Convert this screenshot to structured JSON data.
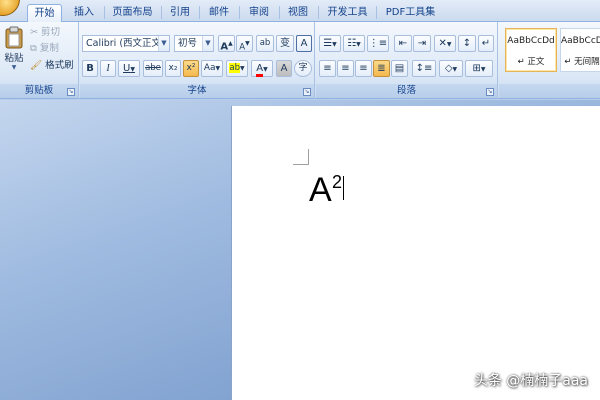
{
  "tabs": [
    {
      "label": "开始"
    },
    {
      "label": "插入"
    },
    {
      "label": "页面布局"
    },
    {
      "label": "引用"
    },
    {
      "label": "邮件"
    },
    {
      "label": "审阅"
    },
    {
      "label": "视图"
    },
    {
      "label": "开发工具"
    },
    {
      "label": "PDF工具集"
    }
  ],
  "clipboard": {
    "paste": "粘贴",
    "cut": "剪切",
    "copy": "复制",
    "format_painter": "格式刷",
    "label": "剪贴板"
  },
  "font": {
    "font_name": "Calibri (西文正文)",
    "font_size": "初号",
    "grow_glyph": "A",
    "shrink_glyph": "A",
    "clear_glyph": "ab",
    "phonetic_glyph": "变",
    "border_glyph": "A",
    "bold": "B",
    "italic": "I",
    "underline": "U",
    "strike": "abe",
    "subscript": "x₂",
    "superscript": "x²",
    "change_case": "Aa",
    "highlight": "ab",
    "font_color": "A",
    "shading_glyph": "A",
    "enclose_glyph": "字",
    "label": "字体"
  },
  "paragraph": {
    "label": "段落"
  },
  "styles": {
    "items": [
      {
        "sample": "AaBbCcDd",
        "name": "↵ 正文"
      },
      {
        "sample": "AaBbCcDd",
        "name": "↵ 无间隔"
      }
    ]
  },
  "document": {
    "base_text": "A",
    "superscript_text": "2"
  },
  "watermark": "头条 @楠楠子aaa",
  "colors": {
    "accent": "#15428b",
    "highlight_yellow": "#ffff00",
    "font_red": "#ff0000",
    "pressed": "#f4b94e"
  }
}
